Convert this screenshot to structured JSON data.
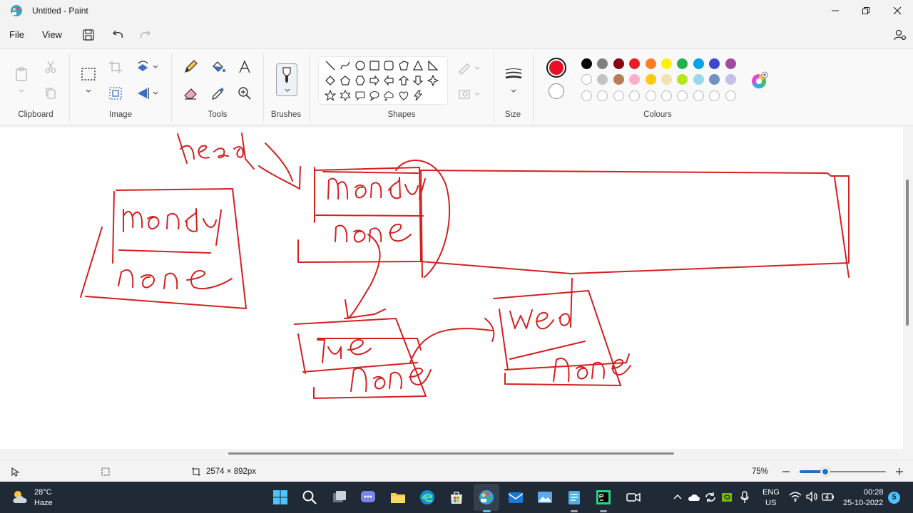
{
  "window": {
    "title": "Untitled - Paint"
  },
  "menu": {
    "file": "File",
    "view": "View"
  },
  "ribbon": {
    "groups": {
      "clipboard": "Clipboard",
      "image": "Image",
      "tools": "Tools",
      "brushes": "Brushes",
      "shapes": "Shapes",
      "size": "Size",
      "colours": "Colours"
    },
    "current_colors": {
      "primary": "#e81123",
      "secondary": "#ffffff"
    },
    "palette_row1": [
      "#000000",
      "#7f7f7f",
      "#880015",
      "#ed1c24",
      "#ff7f27",
      "#fff200",
      "#22b14c",
      "#00a2e8",
      "#3f48cc",
      "#a349a4"
    ],
    "palette_row2": [
      "#ffffff",
      "#c3c3c3",
      "#b97a57",
      "#ffaec9",
      "#ffc90e",
      "#efe4b0",
      "#b5e61d",
      "#99d9ea",
      "#7092be",
      "#c8bfe7"
    ],
    "palette_row3_count": 10
  },
  "drawing": {
    "stroke_color": "#d42020"
  },
  "statusbar": {
    "canvas_size": "2574 × 892px",
    "zoom": "75%",
    "zoom_fraction": 0.3
  },
  "taskbar": {
    "weather_temp": "28°C",
    "weather_desc": "Haze",
    "lang_line1": "ENG",
    "lang_line2": "US",
    "time": "00:28",
    "date": "25-10-2022",
    "notification_count": "5"
  }
}
